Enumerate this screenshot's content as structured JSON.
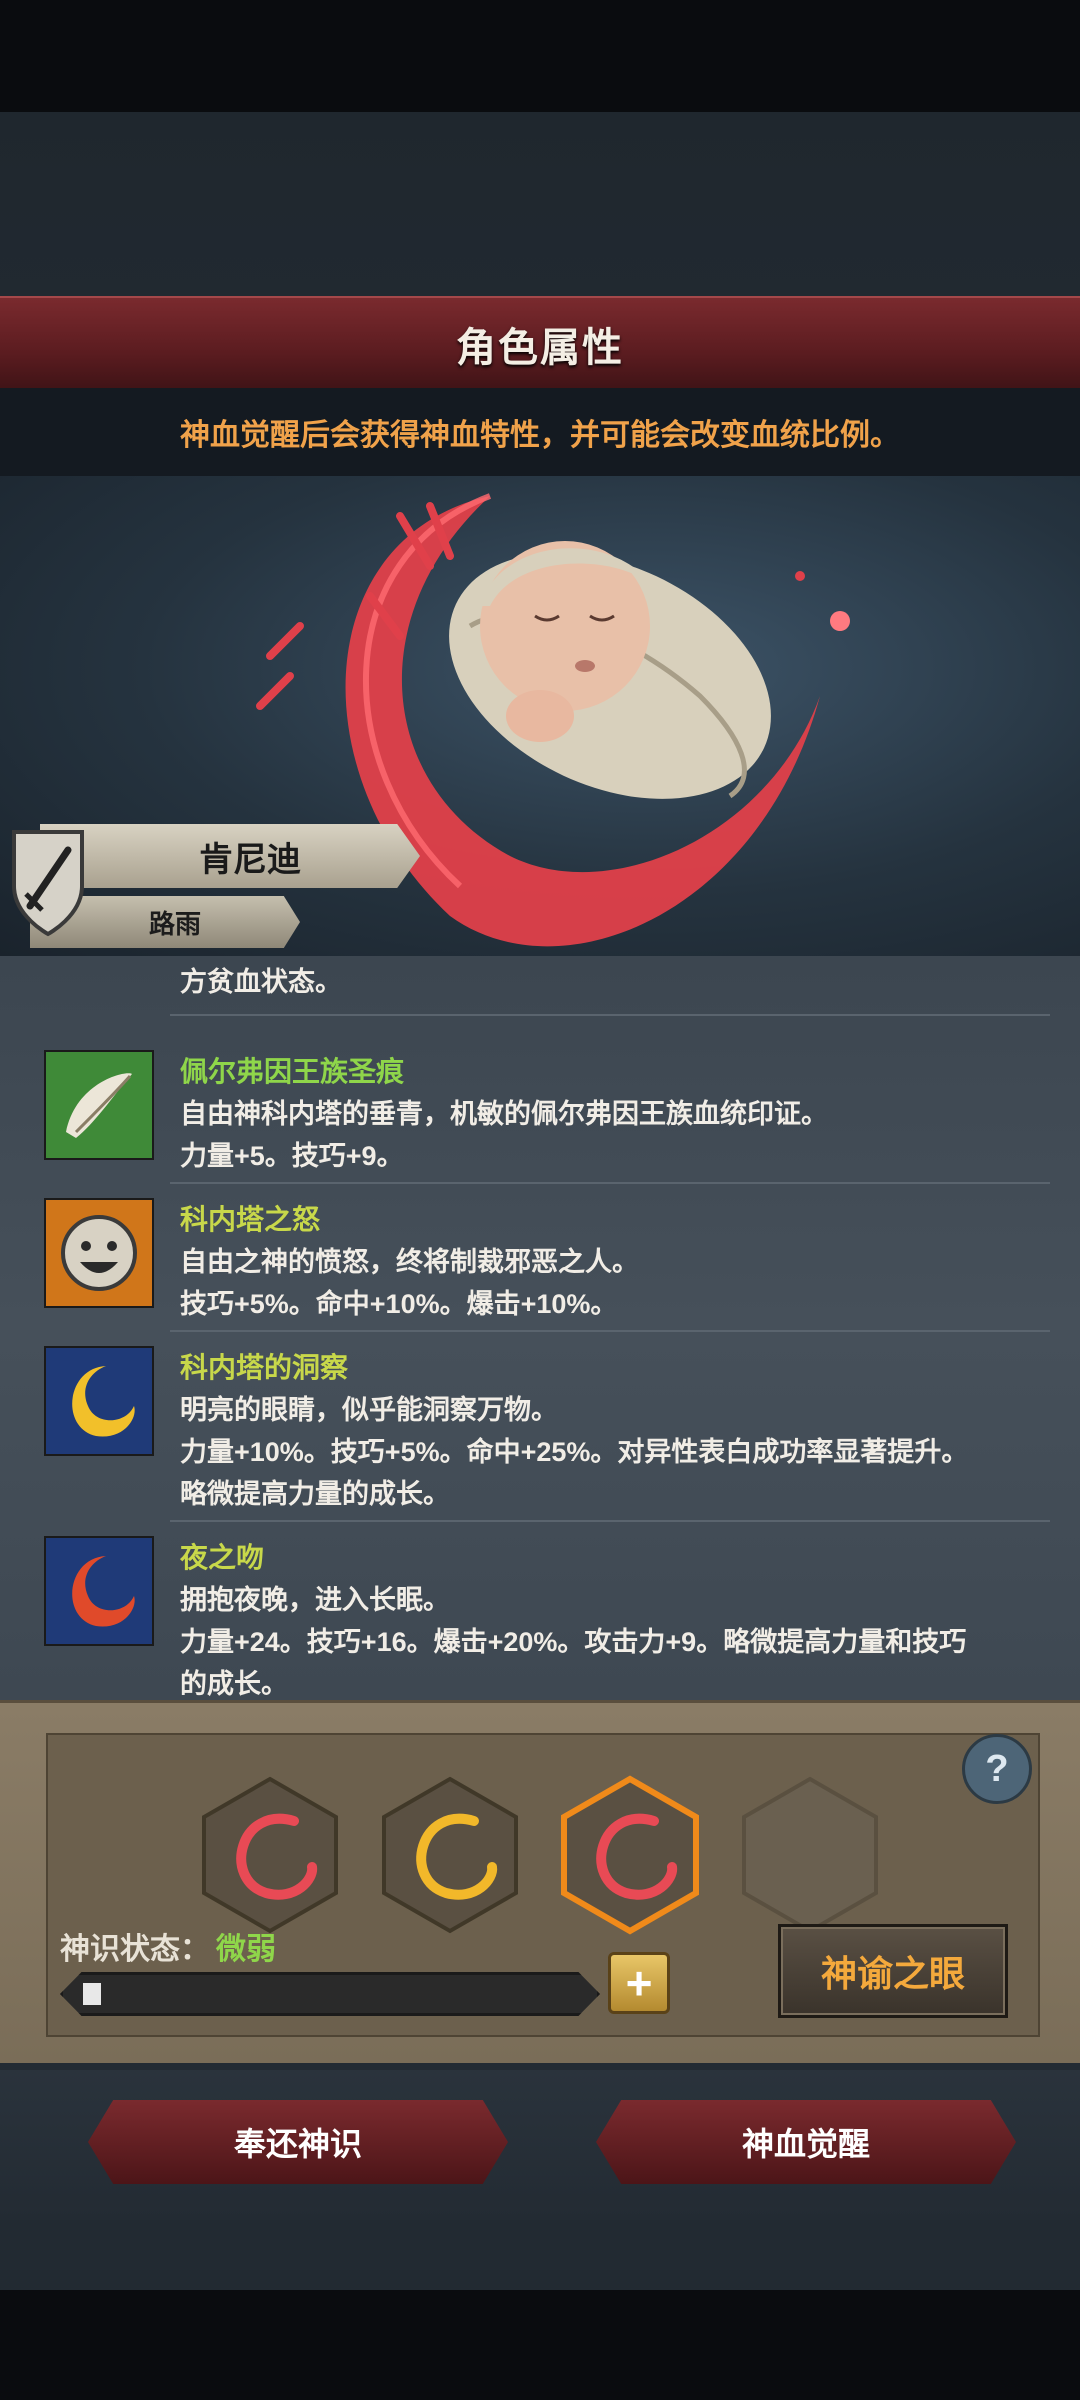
{
  "header": {
    "title": "角色属性"
  },
  "notice": "神血觉醒后会获得神血特性，并可能会改变血统比例。",
  "character": {
    "name": "肯尼迪",
    "title": "路雨"
  },
  "traits": [
    {
      "cut_line": "方贫血状态。",
      "name": "",
      "lines": []
    },
    {
      "name": "佩尔弗因王族圣痕",
      "lines": [
        "自由神科内塔的垂青，机敏的佩尔弗因王族血统印证。",
        "力量+5。技巧+9。"
      ],
      "icon": "feather-icon",
      "color": "#6cb04a"
    },
    {
      "name": "科内塔之怒",
      "lines": [
        "自由之神的愤怒，终将制裁邪恶之人。",
        "技巧+5%。命中+10%。爆击+10%。"
      ],
      "icon": "smile-face-icon",
      "color": "#e07a1a"
    },
    {
      "name": "科内塔的洞察",
      "lines": [
        "明亮的眼睛，似乎能洞察万物。",
        "力量+10%。技巧+5%。命中+25%。对异性表白成功率显著提升。",
        "略微提高力量的成长。"
      ],
      "icon": "crescent-moon-icon",
      "color": "#2a4a8a"
    },
    {
      "name": "夜之吻",
      "lines": [
        "拥抱夜晚，进入长眠。",
        "力量+24。技巧+16。爆击+20%。攻击力+9。略微提高力量和技巧",
        "的成长。"
      ],
      "icon": "red-moon-icon",
      "color": "#2a4a8a"
    }
  ],
  "slots": {
    "help": "?",
    "status_label": "神识状态：",
    "status_value": "微弱",
    "progress": 0.03,
    "plus": "+",
    "oracle_button": "神谕之眼"
  },
  "buttons": {
    "return": "奉还神识",
    "awaken": "神血觉醒"
  },
  "colors": {
    "accent_red": "#7a2a2e",
    "notice": "#f0a24a",
    "trait_name": "#c8d84a",
    "status_good": "#8fd64a"
  }
}
